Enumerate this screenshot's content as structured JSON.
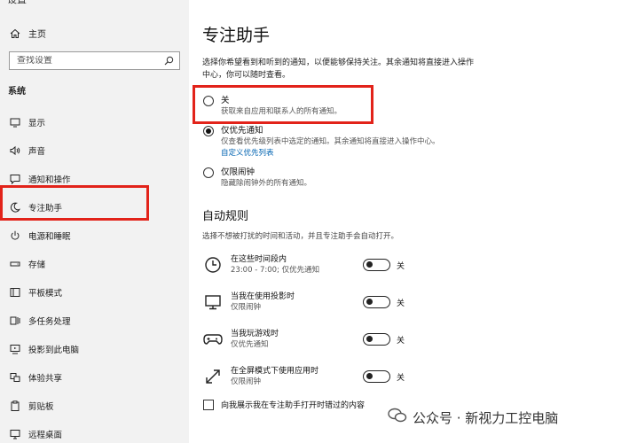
{
  "sidebar": {
    "title": "设置",
    "home_label": "主页",
    "search_placeholder": "查找设置",
    "section_label": "系统",
    "items": [
      {
        "label": "显示",
        "icon": "display-icon"
      },
      {
        "label": "声音",
        "icon": "speaker-icon"
      },
      {
        "label": "通知和操作",
        "icon": "notification-icon"
      },
      {
        "label": "专注助手",
        "icon": "moon-icon"
      },
      {
        "label": "电源和睡眠",
        "icon": "power-icon"
      },
      {
        "label": "存储",
        "icon": "storage-icon"
      },
      {
        "label": "平板模式",
        "icon": "tablet-icon"
      },
      {
        "label": "多任务处理",
        "icon": "multitask-icon"
      },
      {
        "label": "投影到此电脑",
        "icon": "project-icon"
      },
      {
        "label": "体验共享",
        "icon": "share-icon"
      },
      {
        "label": "剪贴板",
        "icon": "clipboard-icon"
      },
      {
        "label": "远程桌面",
        "icon": "remote-desktop-icon"
      }
    ]
  },
  "main": {
    "title": "专注助手",
    "description": "选择你希望看到和听到的通知，以便能够保持关注。其余通知将直接进入操作中心，你可以随时查看。",
    "options": [
      {
        "label": "关",
        "sub": "获取来自应用和联系人的所有通知。",
        "checked": false
      },
      {
        "label": "仅优先通知",
        "sub": "仅查看优先级列表中选定的通知。其余通知将直接进入操作中心。",
        "link": "自定义优先列表",
        "checked": true
      },
      {
        "label": "仅限闹钟",
        "sub": "隐藏除闹钟外的所有通知。",
        "checked": false
      }
    ],
    "auto_rules_title": "自动规则",
    "auto_rules_desc": "选择不想被打扰的时间和活动，并且专注助手会自动打开。",
    "rules": [
      {
        "title": "在这些时间段内",
        "sub": "23:00 - 7:00; 仅优先通知",
        "state": "关",
        "icon": "clock-icon"
      },
      {
        "title": "当我在使用投影时",
        "sub": "仅限闹钟",
        "state": "关",
        "icon": "projector-icon"
      },
      {
        "title": "当我玩游戏时",
        "sub": "仅优先通知",
        "state": "关",
        "icon": "gamepad-icon"
      },
      {
        "title": "在全屏模式下使用应用时",
        "sub": "仅限闹钟",
        "state": "关",
        "icon": "fullscreen-icon"
      }
    ],
    "checkbox_label": "向我展示我在专注助手打开时错过的内容"
  },
  "watermark": "公众号 · 新视力工控电脑",
  "colors": {
    "highlight": "#e2231a",
    "link": "#0063b1",
    "sidebar_bg": "#f2f2f2"
  }
}
